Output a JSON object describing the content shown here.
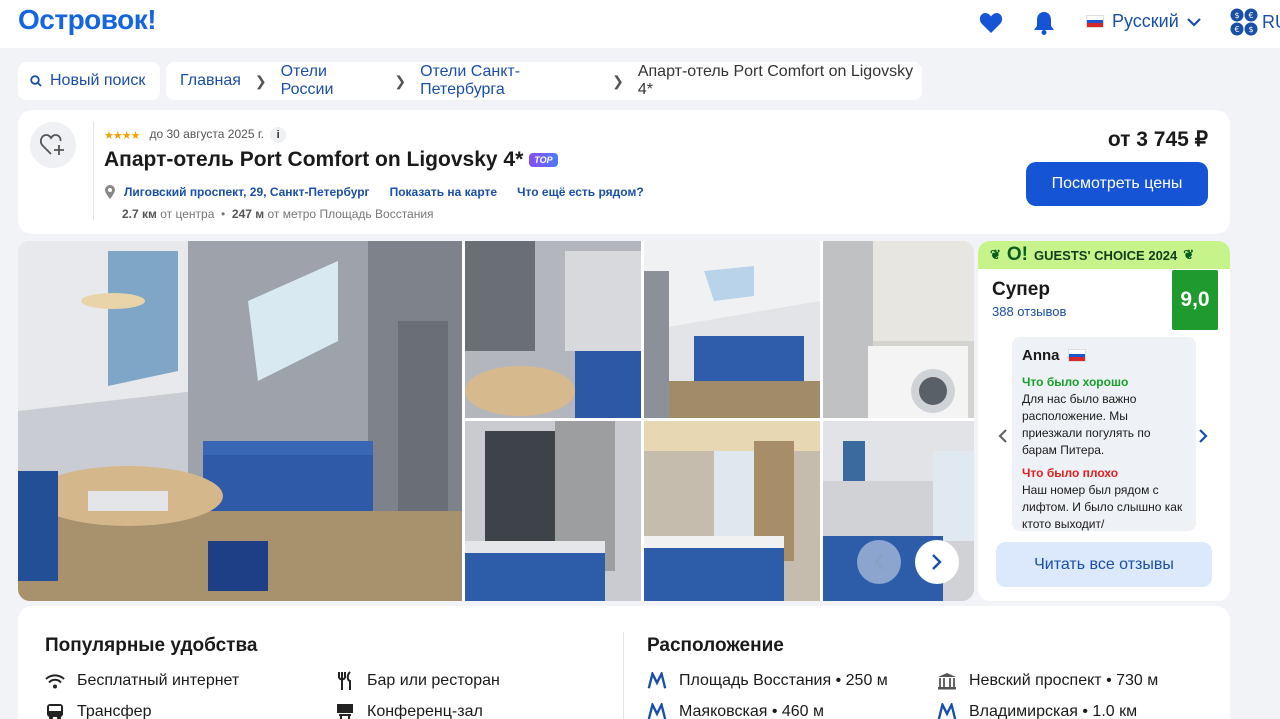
{
  "header": {
    "logo": "Островок!",
    "language": "Русский",
    "currency": "RU"
  },
  "breadcrumbs": {
    "new_search": "Новый поиск",
    "items": [
      "Главная",
      "Отели России",
      "Отели Санкт-Петербурга"
    ],
    "current": "Апарт-отель Port Comfort on Ligovsky 4*"
  },
  "hotel": {
    "stars": "★★★★",
    "stars_rating": 4,
    "date_note": "до 30 августа 2025 г.",
    "info": "i",
    "name": "Апарт-отель Port Comfort on Ligovsky 4*",
    "badge": "TOP",
    "address": "Лиговский проспект, 29, Санкт-Петербург",
    "map_link": "Показать на карте",
    "nearby_link": "Что ещё есть рядом?",
    "center_distance": "2.7 км",
    "center_label": "от центра",
    "metro_distance": "247 м",
    "metro_label": "от метро Площадь Восстания",
    "price": "от 3 745 ₽",
    "price_button": "Посмотреть цены"
  },
  "rating": {
    "guests_choice": "GUESTS' CHOICE 2024",
    "guests_choice_mark": "O!",
    "label": "Супер",
    "reviews_count": "388 отзывов",
    "score": "9,0",
    "review": {
      "author": "Anna",
      "good_title": "Что было хорошо",
      "good_text": "Для нас было важно расположение. Мы приезжали погулять по барам Питера.",
      "bad_title": "Что было плохо",
      "bad_text": "Наш номер был рядом с лифтом. И было слышно как ктото выходит/"
    },
    "read_all": "Читать все отзывы"
  },
  "amenities": {
    "title": "Популярные удобства",
    "items": [
      {
        "label": "Бесплатный интернет",
        "icon": "wifi-icon"
      },
      {
        "label": "Бар или ресторан",
        "icon": "fork-knife-icon"
      },
      {
        "label": "Трансфер",
        "icon": "bus-icon"
      },
      {
        "label": "Конференц-зал",
        "icon": "conference-icon"
      }
    ]
  },
  "location": {
    "title": "Расположение",
    "items": [
      {
        "label": "Площадь Восстания • 250 м",
        "icon": "metro-icon"
      },
      {
        "label": "Невский проспект • 730 м",
        "icon": "landmark-icon"
      },
      {
        "label": "Маяковская • 460 м",
        "icon": "metro-icon"
      },
      {
        "label": "Владимирская • 1.0 км",
        "icon": "metro-icon"
      }
    ]
  },
  "colors": {
    "brand": "#1665e0",
    "link": "#1a4fa8",
    "primary_button": "#1654d6",
    "score_green": "#1e9a2e",
    "guests_choice_bg": "#c6f38a"
  }
}
